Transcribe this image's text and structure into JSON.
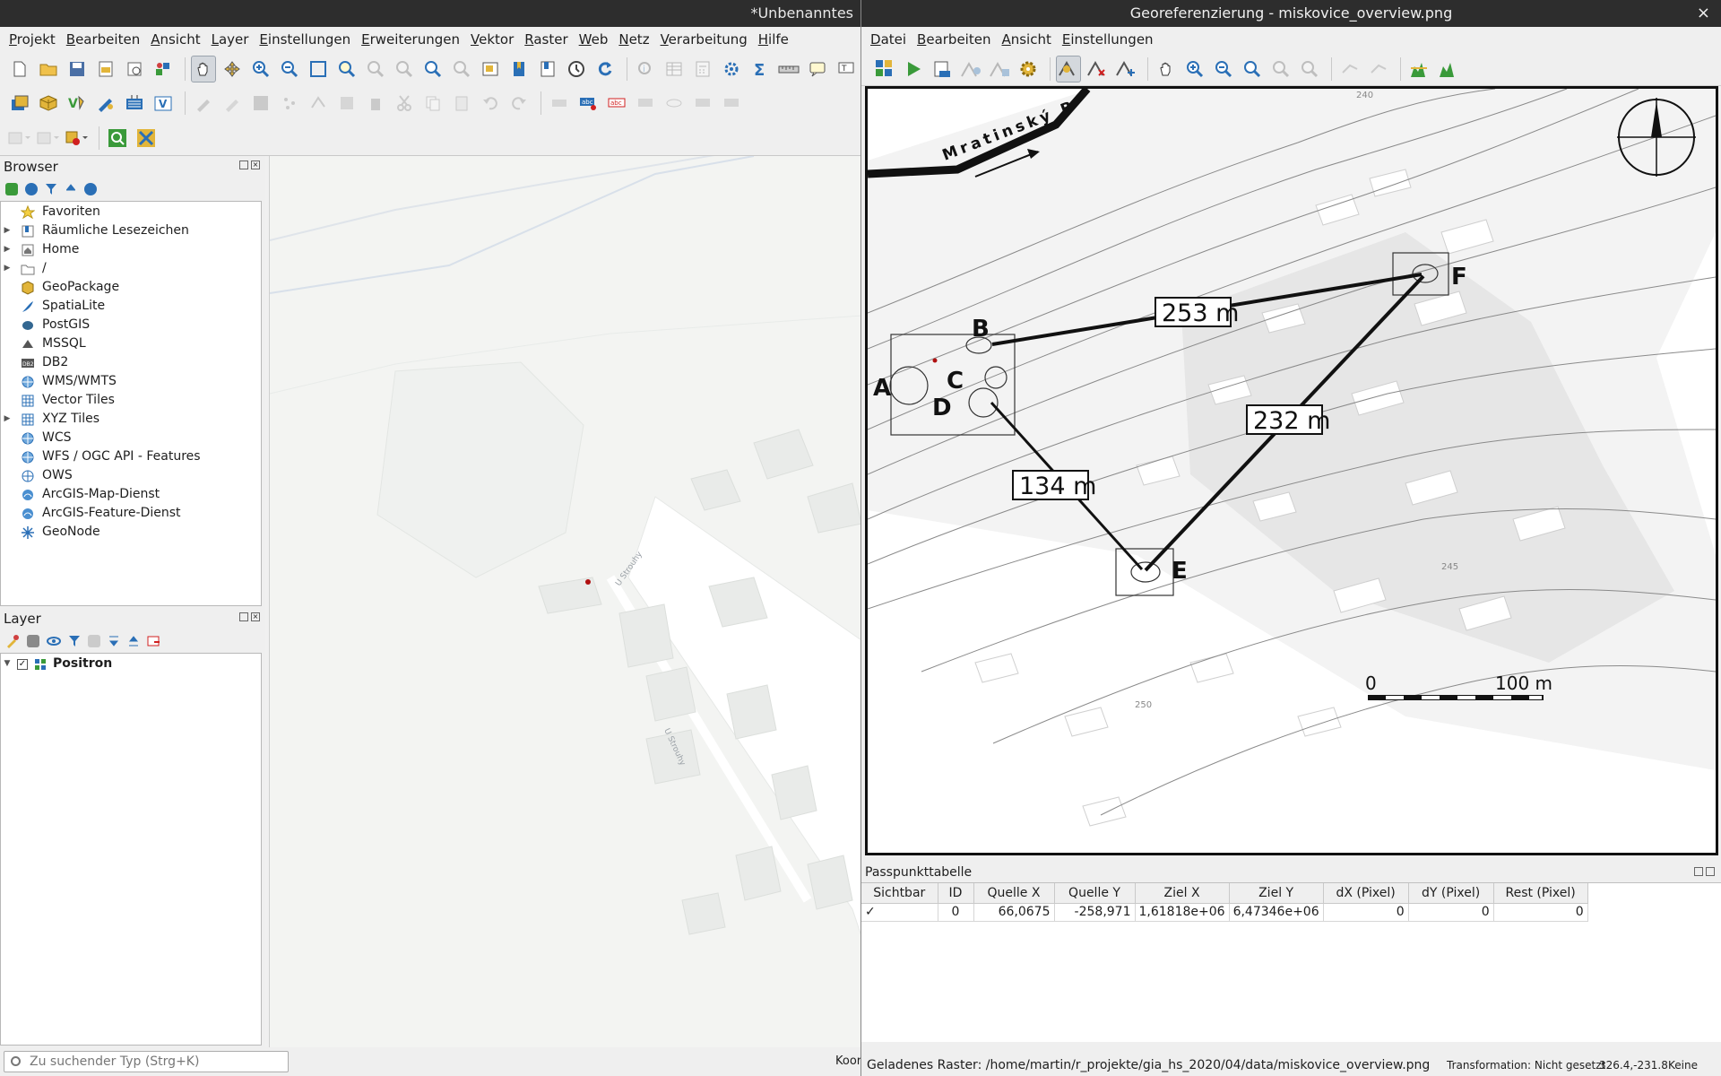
{
  "main": {
    "title": "*Unbenanntes",
    "menu": [
      "Projekt",
      "Bearbeiten",
      "Ansicht",
      "Layer",
      "Einstellungen",
      "Erweiterungen",
      "Vektor",
      "Raster",
      "Web",
      "Netz",
      "Verarbeitung",
      "Hilfe"
    ],
    "browser": {
      "title": "Browser",
      "items": [
        {
          "label": "Favoriten",
          "icon": "star-icon",
          "expand": false
        },
        {
          "label": "Räumliche Lesezeichen",
          "icon": "bookmark-icon",
          "expand": true
        },
        {
          "label": "Home",
          "icon": "home-icon",
          "expand": true
        },
        {
          "label": "/",
          "icon": "folder-icon",
          "expand": true
        },
        {
          "label": "GeoPackage",
          "icon": "geopackage-icon",
          "expand": false
        },
        {
          "label": "SpatiaLite",
          "icon": "feather-icon",
          "expand": false
        },
        {
          "label": "PostGIS",
          "icon": "elephant-icon",
          "expand": false
        },
        {
          "label": "MSSQL",
          "icon": "mssql-icon",
          "expand": false
        },
        {
          "label": "DB2",
          "icon": "db2-icon",
          "expand": false
        },
        {
          "label": "WMS/WMTS",
          "icon": "globe-icon",
          "expand": false
        },
        {
          "label": "Vector Tiles",
          "icon": "grid-icon",
          "expand": false
        },
        {
          "label": "XYZ Tiles",
          "icon": "grid-icon",
          "expand": true
        },
        {
          "label": "WCS",
          "icon": "globe-icon",
          "expand": false
        },
        {
          "label": "WFS / OGC API - Features",
          "icon": "globe-icon",
          "expand": false
        },
        {
          "label": "OWS",
          "icon": "globe-outline-icon",
          "expand": false
        },
        {
          "label": "ArcGIS-Map-Dienst",
          "icon": "arcgis-icon",
          "expand": false
        },
        {
          "label": "ArcGIS-Feature-Dienst",
          "icon": "arcgis-icon",
          "expand": false
        },
        {
          "label": "GeoNode",
          "icon": "geonode-icon",
          "expand": false
        }
      ]
    },
    "layers": {
      "title": "Layer",
      "items": [
        {
          "label": "Positron",
          "checked": true
        }
      ]
    },
    "canvas_labels": {
      "street": "U Strouhy"
    },
    "statusbar": {
      "search_placeholder": "Zu suchender Typ (Strg+K)",
      "coord_label": "Koor"
    }
  },
  "geo": {
    "title": "Georeferenzierung - miskovice_overview.png",
    "menu": [
      "Datei",
      "Bearbeiten",
      "Ansicht",
      "Einstellungen"
    ],
    "raster": {
      "road_label": "Mratinský B",
      "contour_labels": [
        "240",
        "245",
        "250"
      ],
      "points": [
        "A",
        "B",
        "C",
        "D",
        "E",
        "F"
      ],
      "distances": [
        "253 m",
        "232 m",
        "134 m"
      ],
      "scale_start": "0",
      "scale_end": "100 m"
    },
    "gcp": {
      "title": "Passpunkttabelle",
      "columns": [
        "Sichtbar",
        "ID",
        "Quelle X",
        "Quelle Y",
        "Ziel X",
        "Ziel Y",
        "dX (Pixel)",
        "dY (Pixel)",
        "Rest (Pixel)"
      ],
      "rows": [
        {
          "visible": "✓",
          "id": "0",
          "src_x": "66,0675",
          "src_y": "-258,971",
          "dst_x": "1,61818e+06",
          "dst_y": "6,47346e+06",
          "dx": "0",
          "dy": "0",
          "res": "0"
        }
      ]
    },
    "status": {
      "loaded": "Geladenes Raster: /home/martin/r_projekte/gia_hs_2020/04/data/miskovice_overview.png",
      "transformation": "Transformation: Nicht gesetzt",
      "coords": "326.4,-231.8",
      "crs": "Keine"
    }
  },
  "colors": {
    "titlebar": "#2d2d2d",
    "panel": "#efefef",
    "canvas": "#f3f4f2",
    "accent_blue": "#2a6fb6",
    "accent_green": "#3a9a3a",
    "accent_yellow": "#e2b53a",
    "marker_red": "#b01010"
  }
}
